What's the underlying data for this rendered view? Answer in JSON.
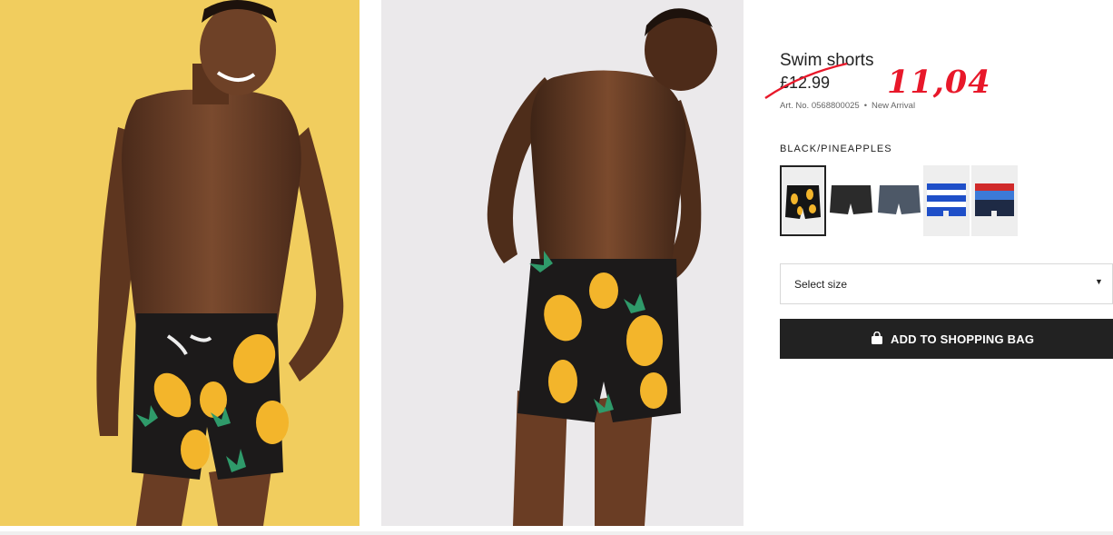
{
  "product": {
    "title": "Swim shorts",
    "original_price": "£12.99",
    "annotated_price": "11,04",
    "art_no": "Art. No. 0568800025",
    "separator": "•",
    "badge": "New Arrival",
    "color_name": "BLACK/PINEAPPLES"
  },
  "swatches": [
    {
      "name": "black-pineapples",
      "selected": true
    },
    {
      "name": "dark-grey"
    },
    {
      "name": "blue-grey"
    },
    {
      "name": "blue-white-stripe"
    },
    {
      "name": "red-blue-block"
    }
  ],
  "size_select": {
    "label": "Select size",
    "icon": "caret-down"
  },
  "add_to_bag": {
    "label": "ADD TO SHOPPING BAG",
    "icon": "shopping-bag-icon"
  },
  "colors": {
    "front_bg": "#f1cd5e",
    "back_bg": "#ebe9eb",
    "button_bg": "#222222",
    "annotation_red": "#e8182a"
  }
}
